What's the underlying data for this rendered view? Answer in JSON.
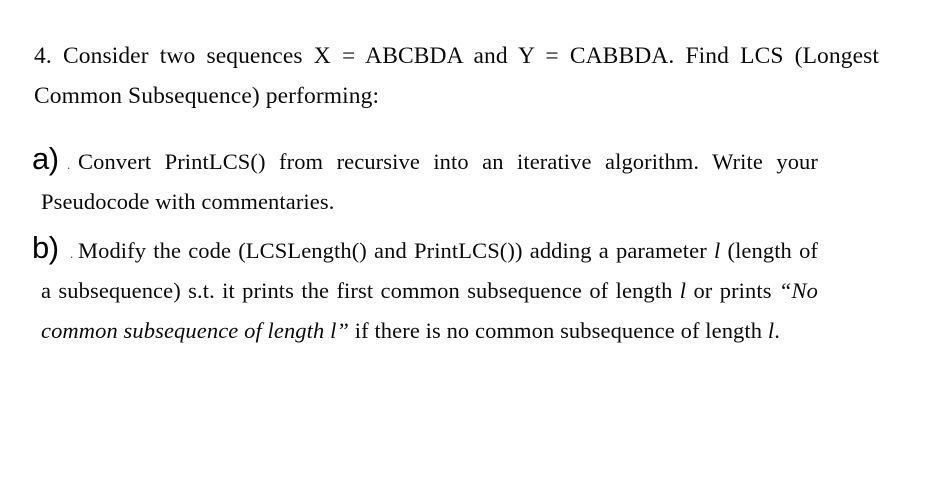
{
  "document": {
    "background_color": "#ffffff",
    "text_color": "#0a0a0a"
  },
  "question": {
    "number": "4.",
    "text": "Consider two sequences X = ABCBDA and Y = CABBDA. Find LCS (Longest Common Subsequence) performing:",
    "full_line_1": "4. Consider two sequences X = ABCBDA and Y = CABBDA. Find LCS (Longest",
    "full_line_2": "Common Subsequence) performing:",
    "sequence_x_label": "X",
    "sequence_x_value": "ABCBDA",
    "sequence_y_label": "Y",
    "sequence_y_value": "CABBDA",
    "acronym": "LCS",
    "acronym_expansion": "Longest Common Subsequence"
  },
  "subitems": [
    {
      "marker": "a)",
      "marker_dot": ".",
      "text_part_1": "Convert PrintLCS() from recursive into an iterative algorithm. Write your Pseudocode with commentaries.",
      "functions": [
        "PrintLCS()"
      ]
    },
    {
      "marker": "b)",
      "marker_dot": ".",
      "text_part_1": "Modify the code (LCSLength() and PrintLCS()) adding a parameter ",
      "param_1": "l",
      "text_part_2": " (length of a subsequence) s.t. it prints the first common subsequence of length ",
      "param_2": "l",
      "text_part_3": " or prints ",
      "quoted_message": "“No common subsequence of length l”",
      "text_part_4": " if there is no common subsequence of length ",
      "param_3": "l",
      "text_part_5": ".",
      "functions": [
        "LCSLength()",
        "PrintLCS()"
      ]
    }
  ]
}
